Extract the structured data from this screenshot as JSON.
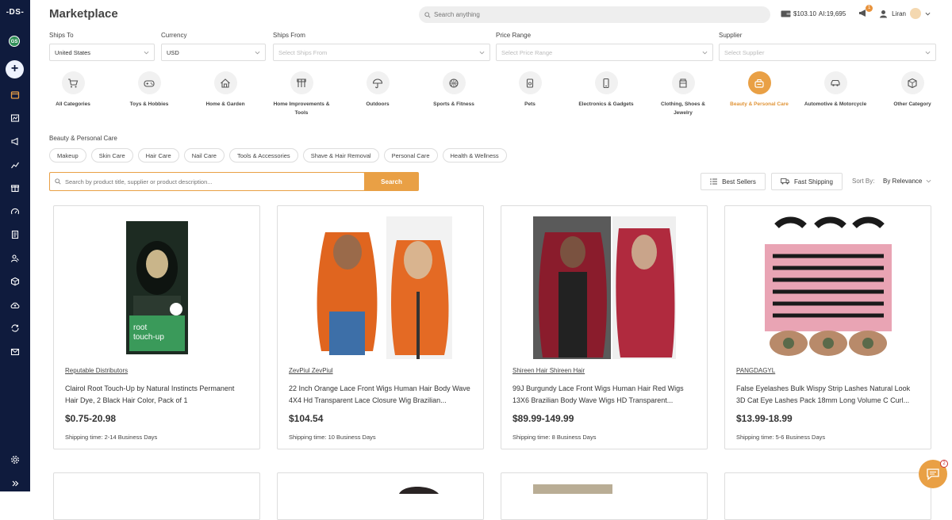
{
  "sidebar": {
    "logo": "-DS-",
    "avatar_initials": "GS",
    "add_label": "+",
    "icons": [
      "store-icon",
      "catalog-icon",
      "megaphone-icon",
      "analytics-icon",
      "gift-icon",
      "speedometer-icon",
      "orders-icon",
      "users-icon",
      "box-icon",
      "cloud-upload-icon",
      "sync-icon",
      "mail-icon",
      "settings-icon",
      "expand-icon"
    ]
  },
  "header": {
    "title": "Marketplace",
    "search_placeholder": "Search anything",
    "wallet_balance": "$103.10",
    "ai_credits": "AI:19,695",
    "notification_count": "1",
    "user_name": "Liran"
  },
  "filters": {
    "ships_to": {
      "label": "Ships To",
      "value": "United States"
    },
    "currency": {
      "label": "Currency",
      "value": "USD"
    },
    "ships_from": {
      "label": "Ships From",
      "placeholder": "Select Ships From"
    },
    "price_range": {
      "label": "Price Range",
      "placeholder": "Select Price Range"
    },
    "supplier": {
      "label": "Supplier",
      "placeholder": "Select Supplier"
    }
  },
  "categories": [
    {
      "label": "All Categories",
      "icon": "cart-icon"
    },
    {
      "label": "Toys & Hobbies",
      "icon": "gamepad-icon"
    },
    {
      "label": "Home & Garden",
      "icon": "house-icon"
    },
    {
      "label": "Home Improvements & Tools",
      "icon": "tools-icon"
    },
    {
      "label": "Outdoors",
      "icon": "umbrella-icon"
    },
    {
      "label": "Sports & Fitness",
      "icon": "basketball-icon"
    },
    {
      "label": "Pets",
      "icon": "pet-food-icon"
    },
    {
      "label": "Electronics & Gadgets",
      "icon": "phone-icon"
    },
    {
      "label": "Clothing, Shoes & Jewelry",
      "icon": "shirt-icon"
    },
    {
      "label": "Beauty & Personal Care",
      "icon": "beauty-icon",
      "active": true
    },
    {
      "label": "Automotive & Motorcycle",
      "icon": "car-icon"
    },
    {
      "label": "Other Category",
      "icon": "cube-icon"
    }
  ],
  "subcategory": {
    "heading": "Beauty & Personal Care",
    "chips": [
      "Makeup",
      "Skin Care",
      "Hair Care",
      "Nail Care",
      "Tools & Accessories",
      "Shave & Hair Removal",
      "Personal Care",
      "Health & Wellness"
    ]
  },
  "product_search": {
    "placeholder": "Search by product title, supplier or product description...",
    "button": "Search"
  },
  "toolbar": {
    "best_sellers": "Best Sellers",
    "fast_shipping": "Fast Shipping",
    "sort_label": "Sort By:",
    "sort_value": "By Relevance"
  },
  "products": [
    {
      "supplier": "Reputable Distributors",
      "title": "Clairol Root Touch-Up by Natural Instincts Permanent Hair Dye, 2 Black Hair Color, Pack of 1",
      "price": "$0.75-20.98",
      "shipping": "Shipping time: 2-14 Business Days",
      "image_colors": [
        "#1d2b22",
        "#3a9a5a",
        "#c9b58a"
      ]
    },
    {
      "supplier": "ZevPiul ZevPiul",
      "title": "22 Inch Orange Lace Front Wigs Human Hair Body Wave 4X4 Hd Transparent Lace Closure Wig Brazilian...",
      "price": "$104.54",
      "shipping": "Shipping time: 10 Business Days",
      "image_colors": [
        "#e0651f",
        "#3d6fa8",
        "#d9b48f"
      ]
    },
    {
      "supplier": "Shireen Hair Shireen Hair",
      "title": "99J Burgundy Lace Front Wigs Human Hair Red Wigs 13X6 Brazilian Body Wave Wigs HD Transparent...",
      "price": "$89.99-149.99",
      "shipping": "Shipping time: 8 Business Days",
      "image_colors": [
        "#8a1c2c",
        "#b02a3e",
        "#c9a48a"
      ]
    },
    {
      "supplier": "PANGDAGYL",
      "title": "False Eyelashes Bulk Wispy Strip Lashes Natural Look 3D Cat Eye Lashes Pack 18mm Long Volume C Curl...",
      "price": "$13.99-18.99",
      "shipping": "Shipping time: 5-6 Business Days",
      "image_colors": [
        "#e9a4b4",
        "#1a1a1a",
        "#b88a6a"
      ]
    }
  ],
  "chat": {
    "badge": "2"
  }
}
